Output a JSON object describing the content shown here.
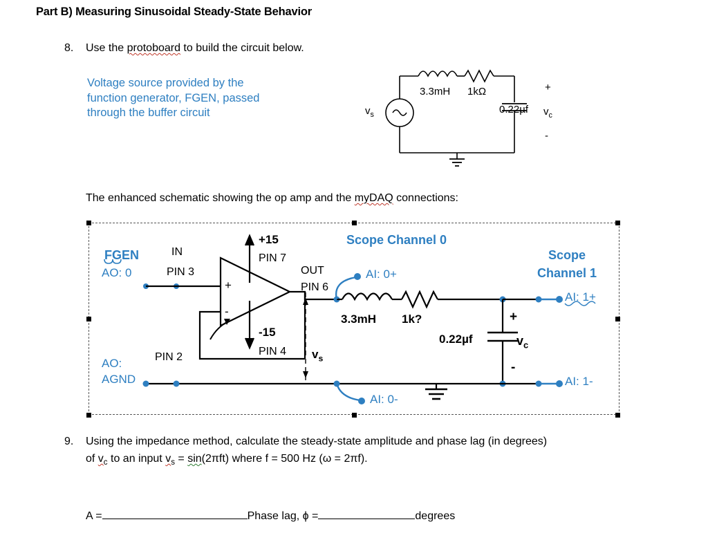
{
  "heading": "Part B) Measuring Sinusoidal Steady-State Behavior",
  "item8": {
    "number": "8.",
    "text_before": "Use the ",
    "spellcheck_word": "protoboard",
    "text_after": " to build the circuit below."
  },
  "blue_note": "Voltage source provided by the function generator, FGEN, passed through the buffer circuit",
  "enhanced_line": {
    "before": "The enhanced schematic showing the op amp and the ",
    "spellcheck_word": "myDAQ",
    "after": " connections:"
  },
  "top_circuit": {
    "source_label": "v",
    "source_sub": "s",
    "inductor": "3.3mH",
    "resistor": "1kΩ",
    "capacitor": "0.22µf",
    "plus": "+",
    "minus": "-",
    "vc_label": "v",
    "vc_sub": "c",
    "source_symbol": "~"
  },
  "schematic": {
    "fgen_label": "FGEN",
    "ao0_label": "AO: 0",
    "in_label": "IN",
    "pin3_label": "PIN 3",
    "plus15_label": "+15",
    "pin7_label": "PIN 7",
    "minus15_label": "-15",
    "pin4_label": "PIN 4",
    "pin2_label": "PIN 2",
    "out_label": "OUT",
    "pin6_label": "PIN 6",
    "opamp_plus": "+",
    "opamp_minus": "-",
    "vs_label": "v",
    "vs_sub": "s",
    "ao_label": "AO:",
    "agnd_label": "AGND",
    "scope_ch0_label": "Scope Channel 0",
    "ai0p_label": "AI: 0+",
    "ai0m_label": "AI: 0-",
    "scope_ch1_label": "Scope Channel 1",
    "ai1p_label": "AI: 1+",
    "ai1m_label": "AI: 1-",
    "inductor": "3.3mH",
    "resistor": "1k?",
    "capacitor": "0.22µf",
    "plus": "+",
    "minus": "-",
    "vc_label": "v",
    "vc_sub": "c"
  },
  "item9": {
    "number": "9.",
    "line1": "Using the impedance method, calculate the steady-state amplitude and phase lag (in degrees)",
    "line2_part1": "of ",
    "line2_vc": "v",
    "line2_vc_sub": "c",
    "line2_part2": " to an input ",
    "line2_vs": "v",
    "line2_vs_sub": "s",
    "line2_part3": " = ",
    "line2_sin": "sin",
    "line2_part4": "(2πft) where f = 500 Hz (ω = 2πf)."
  },
  "answers": {
    "a_label": "A =",
    "phase_label": "Phase lag, ϕ =",
    "degrees_label": "degrees"
  },
  "colors": {
    "blue": "#2e7fc1",
    "black": "#000000",
    "spell_red": "#c0392b",
    "grammar_green": "#2e7d32"
  }
}
